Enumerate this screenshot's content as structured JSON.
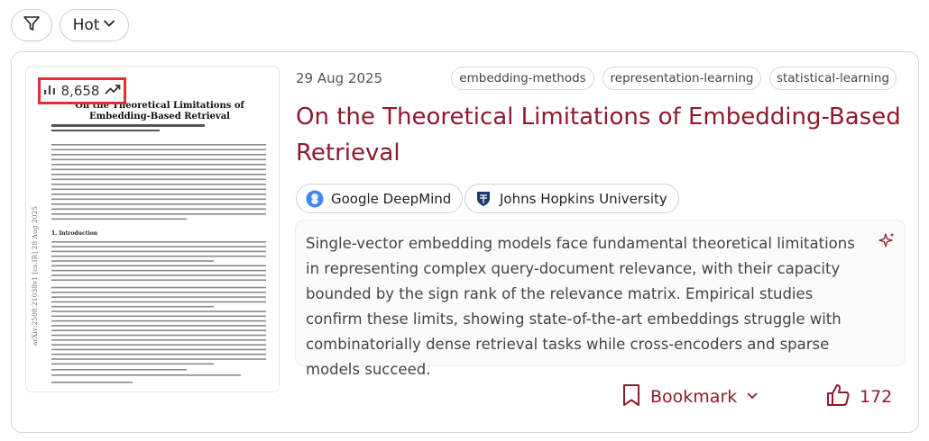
{
  "toolbar": {
    "filter_icon": "filter-icon",
    "sort_label": "Hot"
  },
  "paper": {
    "views": "8,658",
    "date": "29 Aug 2025",
    "tags": [
      "embedding-methods",
      "representation-learning",
      "statistical-learning"
    ],
    "title": "On the Theoretical Limitations of Embedding-Based Retrieval",
    "orgs": [
      {
        "name": "Google DeepMind",
        "logo": "deepmind-logo"
      },
      {
        "name": "Johns Hopkins University",
        "logo": "jhu-logo"
      }
    ],
    "summary": "Single-vector embedding models face fundamental theoretical limitations in representing complex query-document relevance, with their capacity bounded by the sign rank of the relevance matrix. Empirical studies confirm these limits, showing state-of-the-art embeddings struggle with combinatorially dense retrieval tasks while cross-encoders and sparse models succeed.",
    "bookmark_label": "Bookmark",
    "likes": "172"
  },
  "thumbnail": {
    "title": "On the Theoretical Limitations of Embedding-Based Retrieval",
    "side_label": "arXiv:2508.21038v1 [cs.IR] 28 Aug 2025",
    "section": "1. Introduction"
  },
  "colors": {
    "accent": "#8f1a2e",
    "highlight": "#e03030",
    "deepmind": "#4285f4",
    "jhu": "#1b3a6b"
  }
}
